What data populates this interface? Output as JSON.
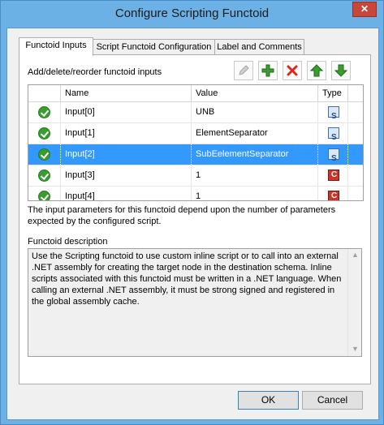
{
  "window": {
    "title": "Configure Scripting Functoid",
    "close_glyph": "✕"
  },
  "tabs": [
    {
      "label": "Functoid Inputs",
      "active": true
    },
    {
      "label": "Script Functoid Configuration",
      "active": false
    },
    {
      "label": "Label and Comments",
      "active": false
    }
  ],
  "inputs": {
    "caption": "Add/delete/reorder functoid inputs",
    "toolbar": [
      {
        "icon": "pencil-icon",
        "name": "edit",
        "enabled": false
      },
      {
        "icon": "plus-icon",
        "name": "add",
        "color": "#3a9d2f"
      },
      {
        "icon": "delete-x-icon",
        "name": "delete",
        "color": "#d8281f"
      },
      {
        "icon": "arrow-up-icon",
        "name": "move-up",
        "color": "#3a9d2f"
      },
      {
        "icon": "arrow-down-icon",
        "name": "move-down",
        "color": "#3a9d2f"
      }
    ],
    "columns": {
      "name": "Name",
      "value": "Value",
      "type": "Type"
    },
    "rows": [
      {
        "name": "Input[0]",
        "value": "UNB",
        "type": "script-icon",
        "selected": false
      },
      {
        "name": "Input[1]",
        "value": "ElementSeparator",
        "type": "script-icon",
        "selected": false
      },
      {
        "name": "Input[2]",
        "value": "SubEelementSeparator",
        "type": "script-icon",
        "selected": true
      },
      {
        "name": "Input[3]",
        "value": "1",
        "type": "constant-icon",
        "selected": false
      },
      {
        "name": "Input[4]",
        "value": "1",
        "type": "constant-icon",
        "selected": false
      }
    ]
  },
  "note": "The input parameters for this functoid depend upon the number of parameters expected by the configured script.",
  "description": {
    "title": "Functoid description",
    "text": "Use the Scripting functoid to use custom inline script or to call into an external .NET assembly for creating the target node in the destination schema. Inline scripts associated with this functoid must be written in a .NET language. When calling an external .NET assembly, it must be strong signed and registered in the global assembly cache."
  },
  "buttons": {
    "ok": "OK",
    "cancel": "Cancel"
  },
  "colors": {
    "titlebar": "#6bb1e6",
    "selection": "#3399ff"
  }
}
